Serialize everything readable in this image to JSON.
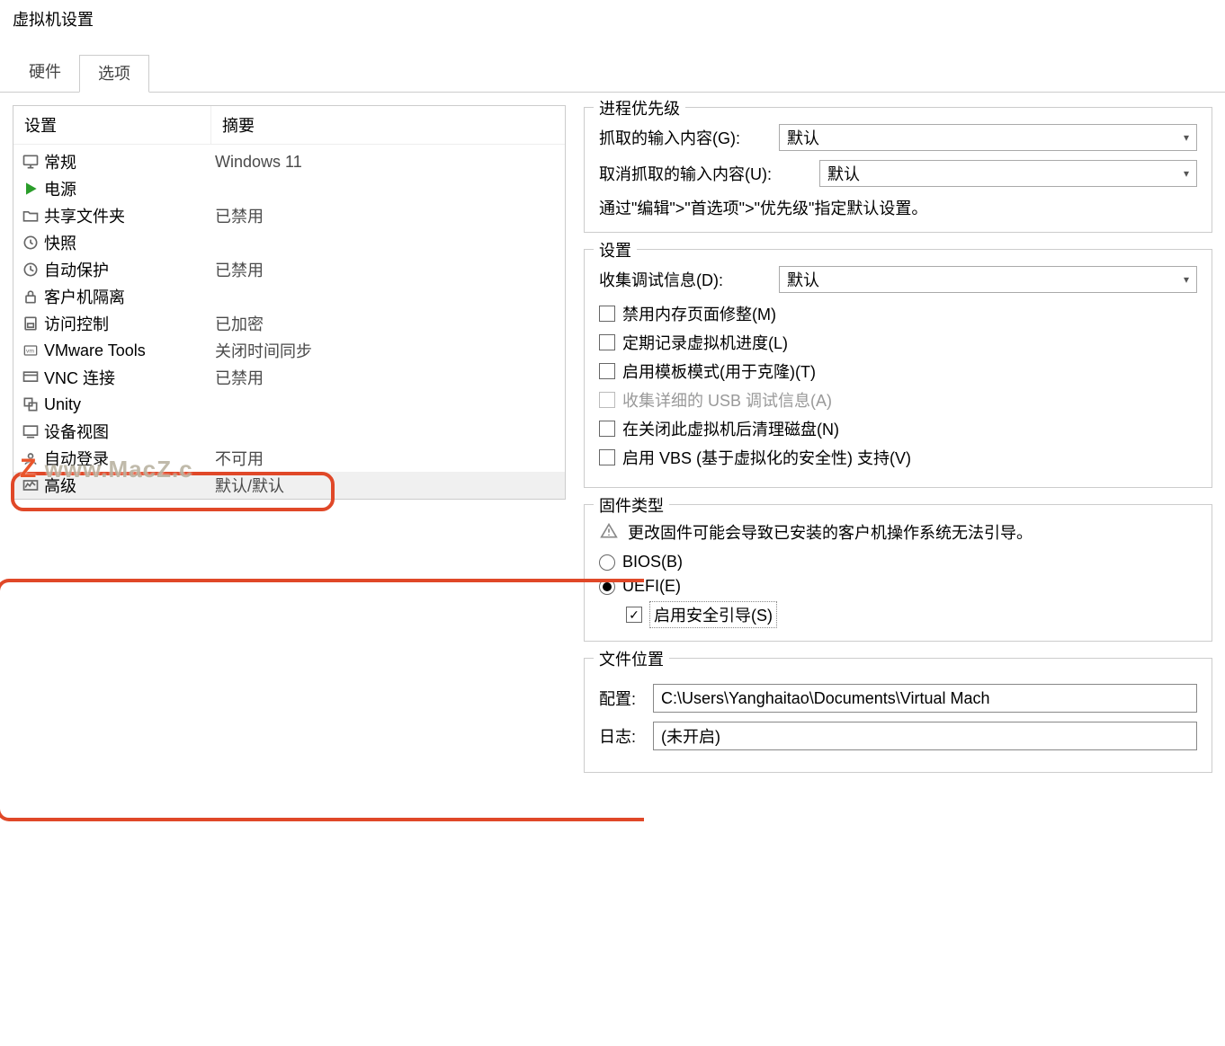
{
  "window": {
    "title": "虚拟机设置"
  },
  "tabs": {
    "hardware": "硬件",
    "options": "选项",
    "active": "options"
  },
  "list": {
    "header_setting": "设置",
    "header_summary": "摘要",
    "rows": [
      {
        "icon": "monitor-icon",
        "label": "常规",
        "summary": "Windows 11"
      },
      {
        "icon": "play-icon",
        "label": "电源",
        "summary": ""
      },
      {
        "icon": "folder-share-icon",
        "label": "共享文件夹",
        "summary": "已禁用"
      },
      {
        "icon": "snapshot-icon",
        "label": "快照",
        "summary": ""
      },
      {
        "icon": "clock-icon",
        "label": "自动保护",
        "summary": "已禁用"
      },
      {
        "icon": "lock-icon",
        "label": "客户机隔离",
        "summary": ""
      },
      {
        "icon": "shield-icon",
        "label": "访问控制",
        "summary": "已加密"
      },
      {
        "icon": "vmtools-icon",
        "label": "VMware Tools",
        "summary": "关闭时间同步"
      },
      {
        "icon": "vnc-icon",
        "label": "VNC 连接",
        "summary": "已禁用"
      },
      {
        "icon": "unity-icon",
        "label": "Unity",
        "summary": ""
      },
      {
        "icon": "device-view-icon",
        "label": "设备视图",
        "summary": ""
      },
      {
        "icon": "autologin-icon",
        "label": "自动登录",
        "summary": "不可用"
      },
      {
        "icon": "advanced-icon",
        "label": "高级",
        "summary": "默认/默认"
      }
    ]
  },
  "priority": {
    "title": "进程优先级",
    "grabbed_label": "抓取的输入内容(G):",
    "ungrabbed_label": "取消抓取的输入内容(U):",
    "grabbed_value": "默认",
    "ungrabbed_value": "默认",
    "hint": "通过\"编辑\">\"首选项\">\"优先级\"指定默认设置。"
  },
  "settings": {
    "title": "设置",
    "debug_label": "收集调试信息(D):",
    "debug_value": "默认",
    "chk_mem_trim": "禁用内存页面修整(M)",
    "chk_log_progress": "定期记录虚拟机进度(L)",
    "chk_template": "启用模板模式(用于克隆)(T)",
    "chk_usb_debug": "收集详细的 USB 调试信息(A)",
    "chk_cleanup": "在关闭此虚拟机后清理磁盘(N)",
    "chk_vbs": "启用 VBS (基于虚拟化的安全性) 支持(V)"
  },
  "firmware": {
    "title": "固件类型",
    "warn": "更改固件可能会导致已安装的客户机操作系统无法引导。",
    "bios": "BIOS(B)",
    "uefi": "UEFI(E)",
    "secure_boot": "启用安全引导(S)"
  },
  "fileloc": {
    "title": "文件位置",
    "config_label": "配置:",
    "config_value": "C:\\Users\\Yanghaitao\\Documents\\Virtual Mach",
    "log_label": "日志:",
    "log_value": "(未开启)"
  },
  "watermark": "www.MacZ.c"
}
